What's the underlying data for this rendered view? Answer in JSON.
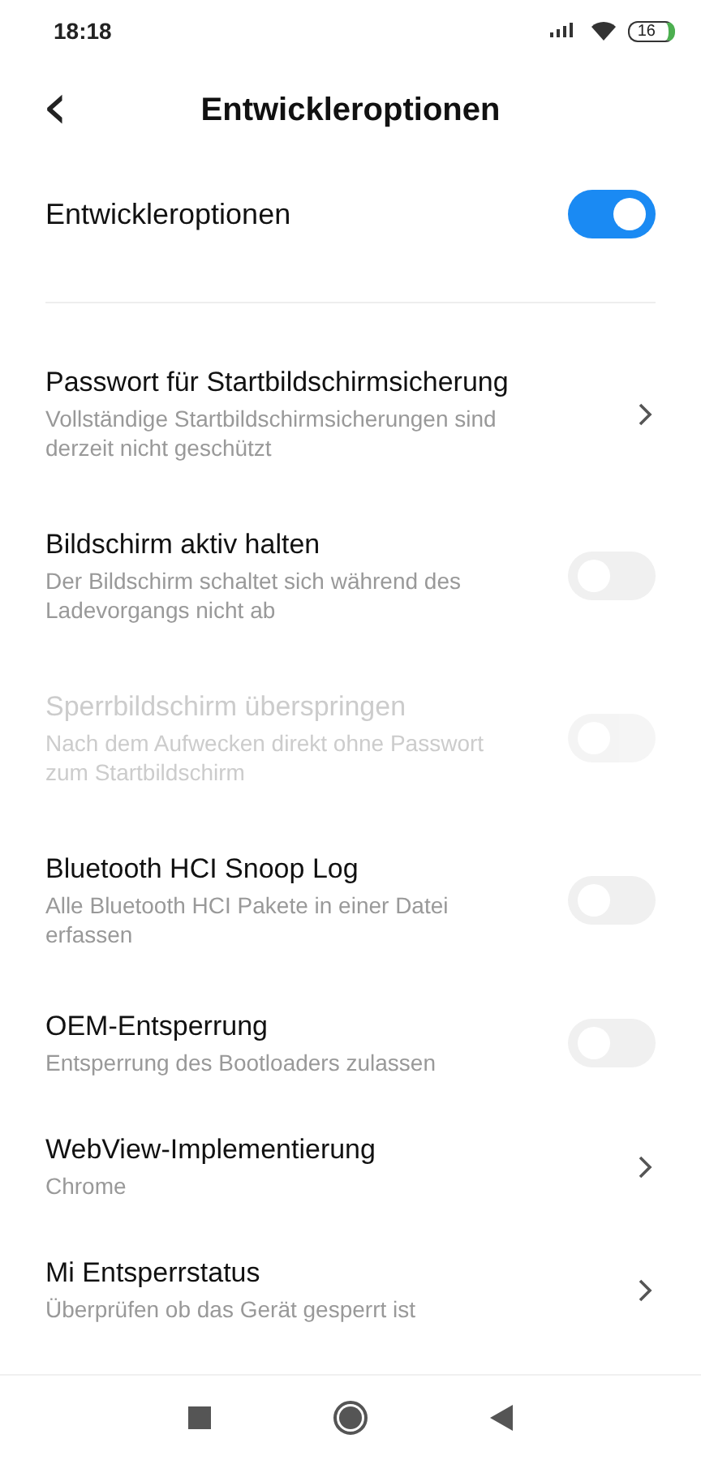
{
  "status_bar": {
    "time": "18:18",
    "battery": "16"
  },
  "header": {
    "back": "‹",
    "title": "Entwickleroptionen"
  },
  "master": {
    "label": "Entwickleroptionen",
    "on": true
  },
  "items": [
    {
      "kind": "link",
      "title": "Passwort für Startbildschirmsicherung",
      "subtitle": "Vollständige Startbildschirmsicherungen sind derzeit nicht geschützt",
      "disabled": false
    },
    {
      "kind": "switch",
      "title": "Bildschirm aktiv halten",
      "subtitle": "Der Bildschirm schaltet sich während des Ladevorgangs nicht ab",
      "on": false,
      "disabled": false
    },
    {
      "kind": "switch",
      "title": "Sperrbildschirm überspringen",
      "subtitle": "Nach dem Aufwecken direkt ohne Passwort zum Startbildschirm",
      "on": false,
      "disabled": true
    },
    {
      "kind": "switch",
      "title": "Bluetooth HCI Snoop Log",
      "subtitle": "Alle Bluetooth HCI Pakete in einer Datei erfassen",
      "on": false,
      "disabled": false
    },
    {
      "kind": "switch",
      "title": "OEM-Entsperrung",
      "subtitle": "Entsperrung des Bootloaders zulassen",
      "on": false,
      "disabled": false
    },
    {
      "kind": "link",
      "title": "WebView-Implementierung",
      "subtitle": "Chrome",
      "disabled": false
    },
    {
      "kind": "link",
      "title": "Mi Entsperrstatus",
      "subtitle": "Überprüfen ob das Gerät gesperrt ist",
      "disabled": false
    }
  ]
}
